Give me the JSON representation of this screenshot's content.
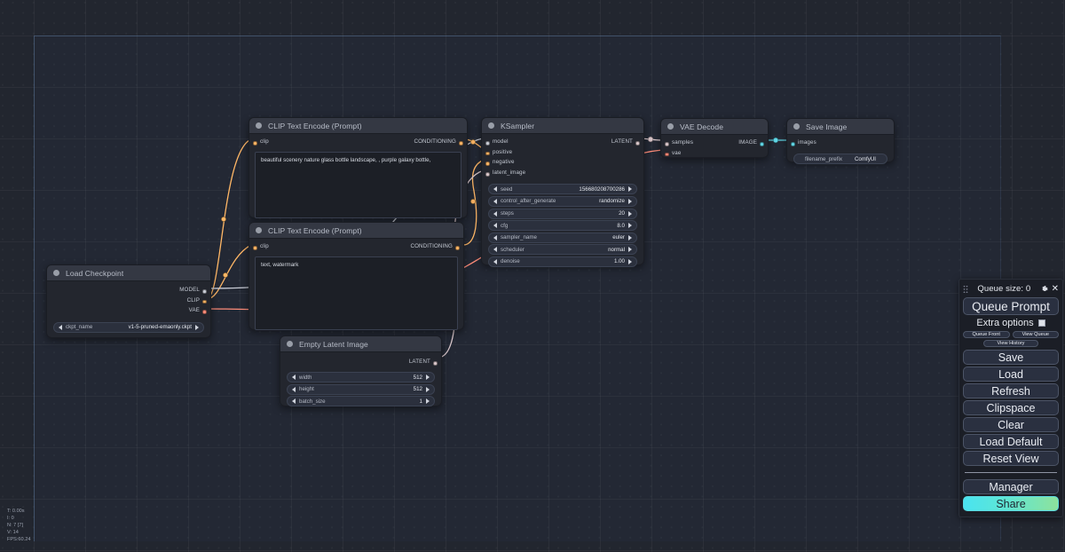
{
  "app": {
    "name": "ComfyUI"
  },
  "canvas": {
    "stats": {
      "time": "T: 0.00s",
      "iterations": "I: 0",
      "nodes": "N: 7 [7]",
      "version": "V: 14",
      "fps": "FPS:60.24"
    }
  },
  "nodes": {
    "load_checkpoint": {
      "title": "Load Checkpoint",
      "outputs": [
        {
          "label": "MODEL",
          "color": "#c9ccd6"
        },
        {
          "label": "CLIP",
          "color": "#ffb766"
        },
        {
          "label": "VAE",
          "color": "#ff8d7a"
        }
      ],
      "widgets": [
        {
          "name": "ckpt_name",
          "value": "v1-5-pruned-emaonly.ckpt"
        }
      ]
    },
    "clip_positive": {
      "title": "CLIP Text Encode (Prompt)",
      "inputs": [
        {
          "label": "clip",
          "color": "#ffb766"
        }
      ],
      "outputs": [
        {
          "label": "CONDITIONING",
          "color": "#ffb766"
        }
      ],
      "text": "beautiful scenery nature glass bottle landscape, , purple galaxy bottle,"
    },
    "clip_negative": {
      "title": "CLIP Text Encode (Prompt)",
      "inputs": [
        {
          "label": "clip",
          "color": "#ffb766"
        }
      ],
      "outputs": [
        {
          "label": "CONDITIONING",
          "color": "#ffb766"
        }
      ],
      "text": "text, watermark"
    },
    "empty_latent": {
      "title": "Empty Latent Image",
      "outputs": [
        {
          "label": "LATENT",
          "color": "#d9c7cb"
        }
      ],
      "widgets": [
        {
          "name": "width",
          "value": "512"
        },
        {
          "name": "height",
          "value": "512"
        },
        {
          "name": "batch_size",
          "value": "1"
        }
      ]
    },
    "ksampler": {
      "title": "KSampler",
      "inputs": [
        {
          "label": "model",
          "color": "#c9ccd6"
        },
        {
          "label": "positive",
          "color": "#ffb766"
        },
        {
          "label": "negative",
          "color": "#ffb766"
        },
        {
          "label": "latent_image",
          "color": "#d9c7cb"
        }
      ],
      "outputs": [
        {
          "label": "LATENT",
          "color": "#d9c7cb"
        }
      ],
      "widgets": [
        {
          "name": "seed",
          "value": "156680208700286"
        },
        {
          "name": "control_after_generate",
          "value": "randomize"
        },
        {
          "name": "steps",
          "value": "20"
        },
        {
          "name": "cfg",
          "value": "8.0"
        },
        {
          "name": "sampler_name",
          "value": "euler"
        },
        {
          "name": "scheduler",
          "value": "normal"
        },
        {
          "name": "denoise",
          "value": "1.00"
        }
      ]
    },
    "vae_decode": {
      "title": "VAE Decode",
      "inputs": [
        {
          "label": "samples",
          "color": "#d9c7cb"
        },
        {
          "label": "vae",
          "color": "#ff8d7a"
        }
      ],
      "outputs": [
        {
          "label": "IMAGE",
          "color": "#62d8e8"
        }
      ]
    },
    "save_image": {
      "title": "Save Image",
      "inputs": [
        {
          "label": "images",
          "color": "#62d8e8"
        }
      ],
      "widgets": [
        {
          "name": "filename_prefix",
          "value": "ComfyUI"
        }
      ]
    }
  },
  "menu": {
    "queue_size_label": "Queue size: 0",
    "close_label": "✕",
    "queue_prompt": "Queue Prompt",
    "extra_options": "Extra options",
    "queue_front": "Queue Front",
    "view_queue": "View Queue",
    "view_history": "View History",
    "save": "Save",
    "load": "Load",
    "refresh": "Refresh",
    "clipspace": "Clipspace",
    "clear": "Clear",
    "load_default": "Load Default",
    "reset_view": "Reset View",
    "manager": "Manager",
    "share": "Share"
  },
  "colors": {
    "canvas_bg": "#22262f",
    "node_bg": "#23262e",
    "node_title_bg": "#343843",
    "link_clip": "#ffb766",
    "link_model": "#c9ccd6",
    "link_vae": "#ff8d7a",
    "link_latent": "#d9c7cb",
    "link_image": "#62d8e8",
    "share_gradient_start": "#49e3f0",
    "share_gradient_end": "#8de29c"
  }
}
